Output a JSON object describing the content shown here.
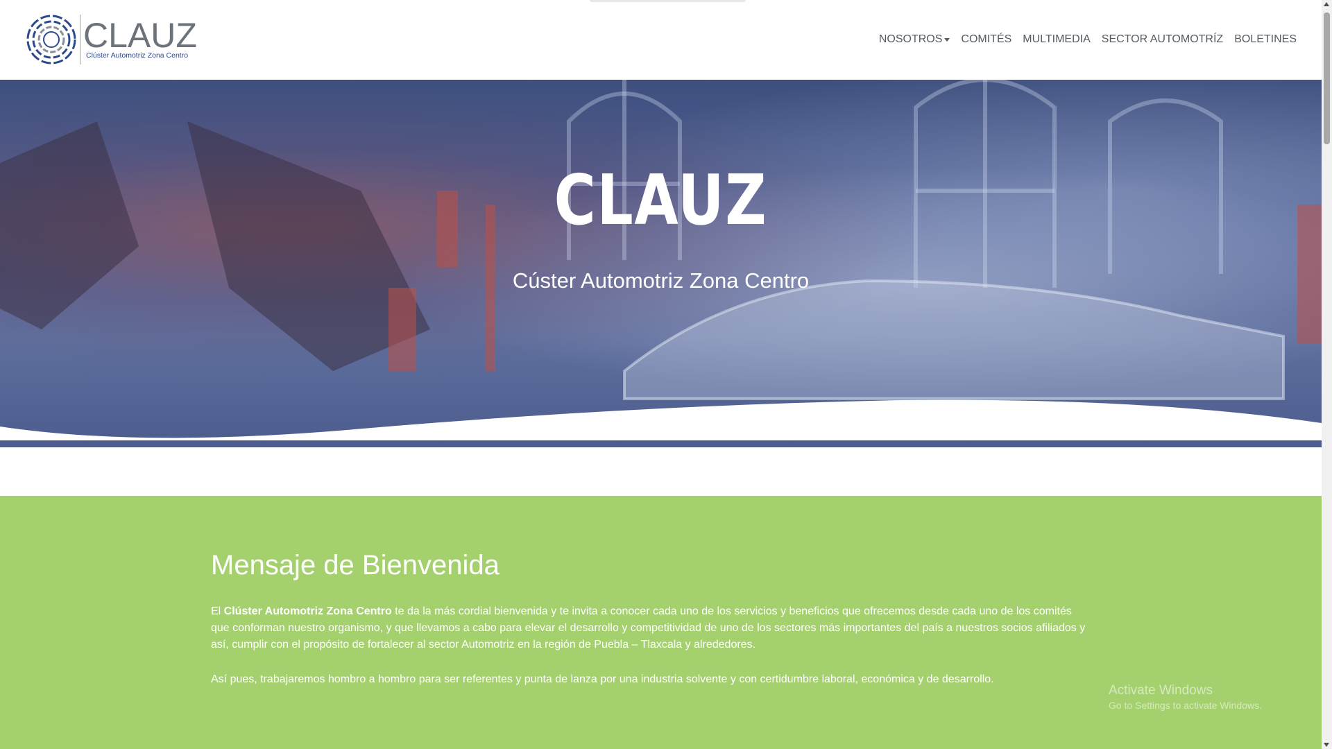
{
  "brand": {
    "logo_word": "CLAUZ",
    "logo_subtitle": "Clúster Automotriz Zona Centro",
    "colors": {
      "logo_blue": "#2b4a8c",
      "logo_gray": "#6d737a"
    }
  },
  "nav": {
    "items": [
      {
        "label": "NOSOTROS",
        "has_dropdown": true
      },
      {
        "label": "COMITÉS"
      },
      {
        "label": "MULTIMEDIA"
      },
      {
        "label": "SECTOR AUTOMOTRÍZ"
      },
      {
        "label": "BOLETINES"
      }
    ]
  },
  "hero": {
    "title": "CLAUZ",
    "subtitle": "Cúster Automotriz Zona Centro",
    "overlay_color": "#4a5a8c"
  },
  "welcome": {
    "title": "Mensaje de Bienvenida",
    "p1_prefix": "El ",
    "p1_bold": "Clúster Automotriz Zona Centro",
    "p1_rest": " te da la más cordial bienvenida y te invita a conocer cada uno de los servicios y beneficios que ofrecemos desde cada uno de los comités que conforman nuestro organismo, y que llevamos a cabo para elevar el desarrollo y competitividad de uno de los sectores más importantes del país a nuestros socios afiliados y así, cumplir con el propósito de fortalecer al sector Automotriz en la región de Puebla – Tlaxcala y alrededores.",
    "p2": "Así pues, trabajaremos hombro a hombro para ser referentes y punta de lanza por una industria solvente y con certidumbre laboral, económica y de desarrollo.",
    "background": "#a4d06e"
  },
  "watermark": {
    "title": "Activate Windows",
    "subtitle": "Go to Settings to activate Windows."
  }
}
